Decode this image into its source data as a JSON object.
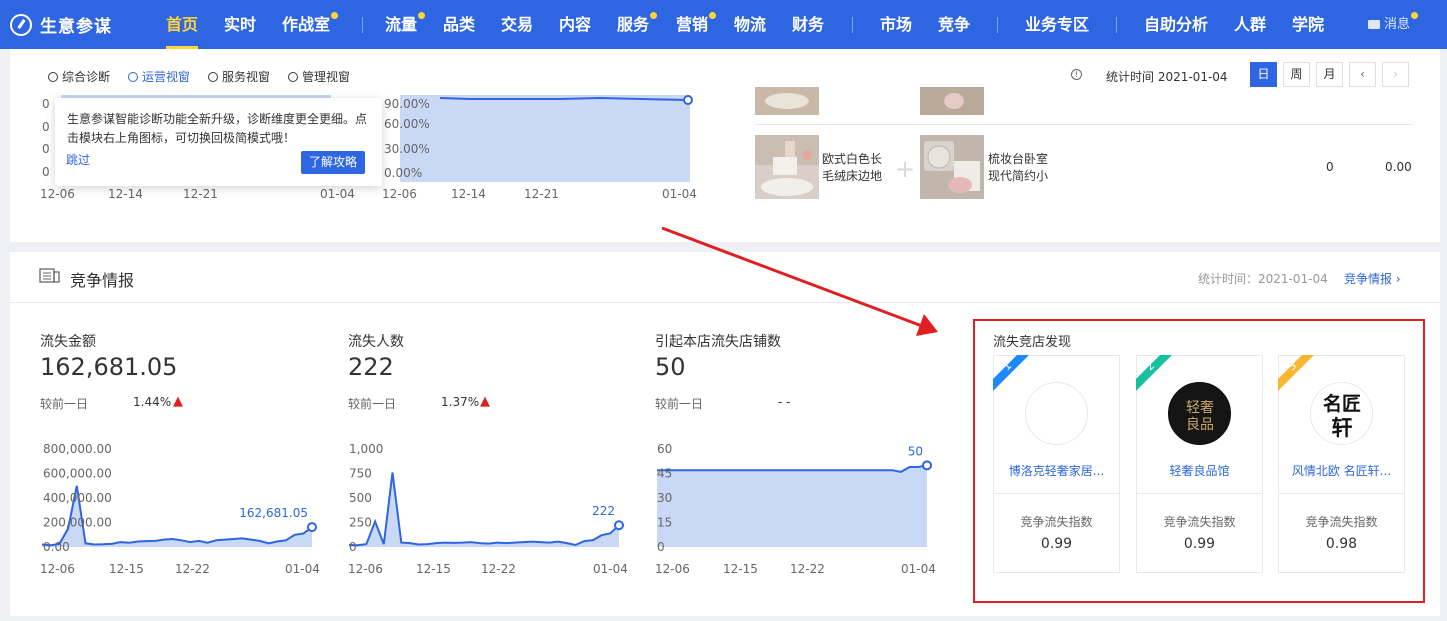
{
  "app": {
    "name": "生意参谋"
  },
  "nav": {
    "items": [
      {
        "label": "首页",
        "active": true,
        "dot": false
      },
      {
        "label": "实时",
        "dot": false
      },
      {
        "label": "作战室",
        "dot": true
      },
      {
        "label": "流量",
        "dot": true
      },
      {
        "label": "品类",
        "dot": false
      },
      {
        "label": "交易",
        "dot": false
      },
      {
        "label": "内容",
        "dot": false
      },
      {
        "label": "服务",
        "dot": true
      },
      {
        "label": "营销",
        "dot": true
      },
      {
        "label": "物流",
        "dot": false
      },
      {
        "label": "财务",
        "dot": false
      },
      {
        "label": "市场",
        "dot": false
      },
      {
        "label": "竞争",
        "dot": false
      },
      {
        "label": "业务专区",
        "dot": false
      },
      {
        "label": "自助分析",
        "dot": false
      },
      {
        "label": "人群",
        "dot": false
      },
      {
        "label": "学院",
        "dot": false
      }
    ],
    "message": "消息"
  },
  "subnav": {
    "tabs": [
      {
        "label": "综合诊断",
        "active": false
      },
      {
        "label": "运营视窗",
        "active": true
      },
      {
        "label": "服务视窗",
        "active": false
      },
      {
        "label": "管理视窗",
        "active": false
      }
    ],
    "stat_time": "统计时间 2021-01-04",
    "periods": [
      "日",
      "周",
      "月"
    ],
    "active_period": "日"
  },
  "popover": {
    "text": "生意参谋智能诊断功能全新升级，诊断维度更全更细。点击模块右上角图标，可切换回极简模式哦！",
    "skip": "跳过",
    "button": "了解攻略"
  },
  "upper_charts": {
    "left_x_ticks": [
      "12-06",
      "12-14",
      "12-21",
      "01-04"
    ],
    "right_x_ticks": [
      "12-06",
      "12-14",
      "12-21",
      "01-04"
    ],
    "y_ticks_right": [
      "90.00%",
      "60.00%",
      "30.00%",
      "0.00%"
    ],
    "y_ticks_left_partial": [
      "0",
      "0",
      "0",
      "0"
    ]
  },
  "products": [
    {
      "name": "欧式白色长毛绒床边地",
      "pair_name": "梳妆台卧室现代简约小",
      "v1": "0",
      "v2": "0.00"
    }
  ],
  "competition": {
    "title": "竞争情报",
    "stat_time": "统计时间：2021-01-04",
    "link": "竞争情报"
  },
  "metrics": [
    {
      "label": "流失金额",
      "value": "162,681.05",
      "compare_label": "较前一日",
      "pct": "1.44%",
      "trend": "up"
    },
    {
      "label": "流失人数",
      "value": "222",
      "compare_label": "较前一日",
      "pct": "1.37%",
      "trend": "up"
    },
    {
      "label": "引起本店流失店铺数",
      "value": "50",
      "compare_label": "较前一日",
      "pct": "- -",
      "trend": "none"
    }
  ],
  "chart_data": [
    {
      "type": "area",
      "x_ticks": [
        "12-06",
        "12-15",
        "12-22",
        "01-04"
      ],
      "y_ticks": [
        "800,000.00",
        "600,000.00",
        "400,000.00",
        "200,000.00",
        "0.00"
      ],
      "ylim": [
        0,
        800000
      ],
      "values": [
        20000,
        15000,
        25000,
        150000,
        500000,
        30000,
        20000,
        22000,
        25000,
        40000,
        35000,
        45000,
        48000,
        50000,
        60000,
        65000,
        55000,
        40000,
        50000,
        35000,
        55000,
        60000,
        65000,
        70000,
        60000,
        50000,
        30000,
        45000,
        55000,
        100000,
        110000,
        162681
      ],
      "end_label": "162,681.05",
      "color": "#2d66e0"
    },
    {
      "type": "area",
      "x_ticks": [
        "12-06",
        "12-15",
        "12-22",
        "01-04"
      ],
      "y_ticks": [
        "1,000",
        "750",
        "500",
        "250",
        "0"
      ],
      "ylim": [
        0,
        1000
      ],
      "values": [
        20,
        18,
        30,
        260,
        30,
        760,
        45,
        40,
        25,
        30,
        40,
        45,
        42,
        45,
        50,
        40,
        35,
        45,
        40,
        45,
        50,
        55,
        50,
        45,
        55,
        40,
        20,
        60,
        70,
        120,
        140,
        222
      ],
      "end_label": "222",
      "color": "#2d66e0"
    },
    {
      "type": "area",
      "x_ticks": [
        "12-06",
        "12-15",
        "12-22",
        "01-04"
      ],
      "y_ticks": [
        "60",
        "45",
        "30",
        "15",
        "0"
      ],
      "ylim": [
        0,
        60
      ],
      "values": [
        47,
        47,
        47,
        47,
        47,
        47,
        47,
        47,
        47,
        47,
        47,
        47,
        47,
        47,
        47,
        47,
        47,
        47,
        47,
        47,
        47,
        47,
        47,
        47,
        47,
        47,
        47,
        47,
        46,
        49,
        49,
        50
      ],
      "end_label": "50",
      "color": "#2d66e0"
    }
  ],
  "competitors": {
    "title": "流失竞店发现",
    "items": [
      {
        "rank": "1",
        "name": "博洛克轻奢家居...",
        "index_label": "竞争流失指数",
        "index": "0.99",
        "ribbon": "#1e88ff"
      },
      {
        "rank": "2",
        "name": "轻奢良品馆",
        "index_label": "竞争流失指数",
        "index": "0.99",
        "ribbon": "#16c0a0",
        "logo_text": "轻奢良品"
      },
      {
        "rank": "3",
        "name": "风情北欧 名匠轩...",
        "index_label": "竞争流失指数",
        "index": "0.98",
        "ribbon": "#f7b733",
        "logo_text": "名匠轩"
      }
    ]
  }
}
